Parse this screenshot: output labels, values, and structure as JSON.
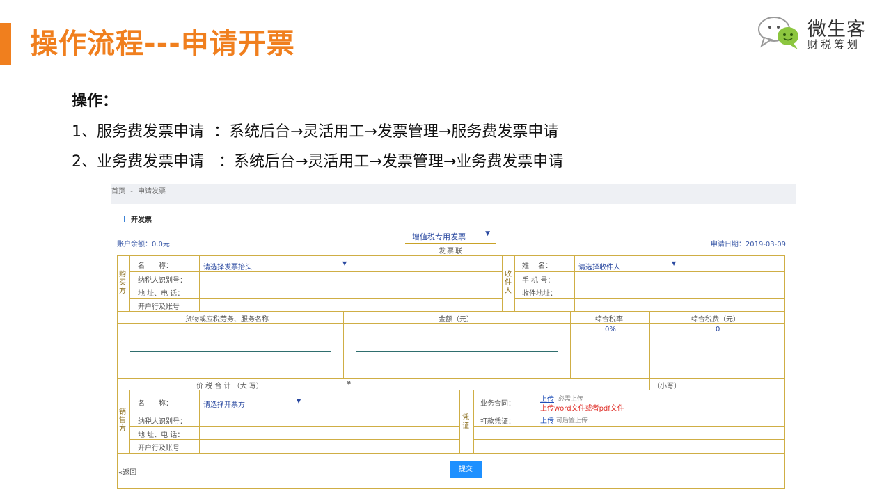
{
  "slide": {
    "title": "操作流程---申请开票",
    "logo_name": "微生客",
    "logo_sub": "财税筹划",
    "op_heading": "操作：",
    "steps": [
      "1、服务费发票申请  ：系统后台→灵活用工→发票管理→服务费发票申请",
      "2、业务费发票申请   ：系统后台→灵活用工→发票管理→业务费发票申请"
    ]
  },
  "app": {
    "breadcrumb": {
      "home": "首页",
      "sep": "-",
      "current": "申请发票"
    },
    "panel_title": "开发票",
    "balance": "账户余额：0.0元",
    "invoice_type": "增值税专用发票",
    "copy_label": "发票联",
    "apply_date_label": "申请日期：",
    "apply_date": "2019-03-09",
    "buyer": {
      "section": "购买方",
      "name_label": "名　　称：",
      "name_placeholder": "请选择发票抬头",
      "taxid_label": "纳税人识别号：",
      "addr_label": "地 址、电 话：",
      "bank_label": "开户行及账号"
    },
    "receiver": {
      "section": "收件人",
      "name_label": "姓　 名：",
      "name_placeholder": "请选择收件人",
      "phone_label": "手 机 号：",
      "addr_label": "收件地址："
    },
    "items": {
      "col_goods": "货物或应税劳务、服务名称",
      "col_amount": "金额（元）",
      "col_rate": "综合税率",
      "col_tax": "综合税费（元）",
      "rate_value": "0%",
      "tax_value": "0",
      "total_label": "价 税 合 计 （大 写）",
      "yen": "¥",
      "small_label": "（小写）"
    },
    "seller": {
      "section": "销售方",
      "name_label": "名　　称：",
      "name_placeholder": "请选择开票方",
      "taxid_label": "纳税人识别号：",
      "addr_label": "地 址、电 话：",
      "bank_label": "开户行及账号"
    },
    "voucher": {
      "section": "凭证",
      "contract_label": "业务合同：",
      "contract_upload": "上传",
      "contract_hint": "必需上传",
      "contract_note": "上传word文件或者pdf文件",
      "payment_label": "打款凭证：",
      "payment_upload": "上传",
      "payment_hint": "可后置上传"
    },
    "back_label": "«返回",
    "submit_label": "提交"
  }
}
